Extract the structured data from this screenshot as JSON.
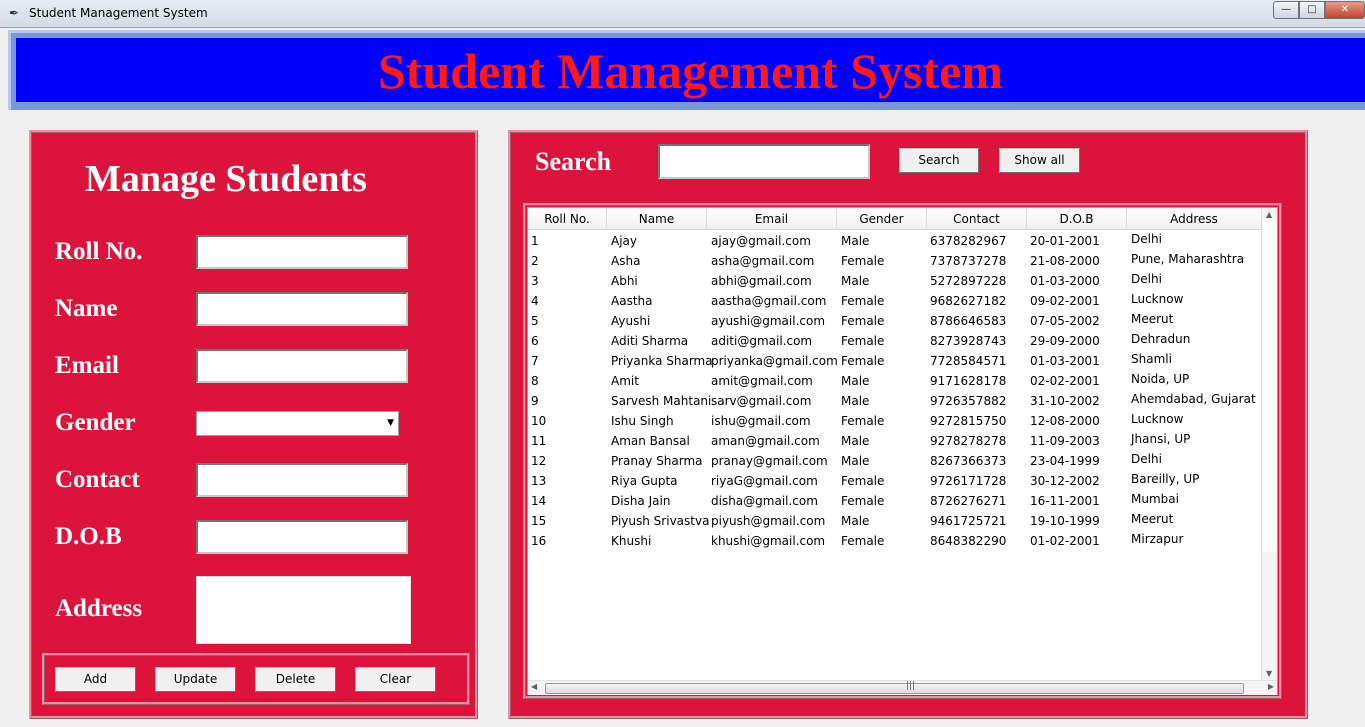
{
  "window": {
    "title": "Student Management System",
    "icon": "feather-icon"
  },
  "header": {
    "title": "Student Management System"
  },
  "colors": {
    "header_bg": "#0000ff",
    "header_text": "#ff1a1a",
    "panel_bg": "#dc143c",
    "panel_text": "#ffffff"
  },
  "manage": {
    "title": "Manage Students",
    "labels": {
      "roll": "Roll No.",
      "name": "Name",
      "email": "Email",
      "gender": "Gender",
      "contact": "Contact",
      "dob": "D.O.B",
      "address": "Address"
    },
    "values": {
      "roll": "",
      "name": "",
      "email": "",
      "gender": "",
      "contact": "",
      "dob": "",
      "address": ""
    },
    "buttons": {
      "add": "Add",
      "update": "Update",
      "delete": "Delete",
      "clear": "Clear"
    }
  },
  "search": {
    "label": "Search",
    "value": "",
    "search_button": "Search",
    "show_all_button": "Show all"
  },
  "table": {
    "columns": [
      "Roll No.",
      "Name",
      "Email",
      "Gender",
      "Contact",
      "D.O.B",
      "Address"
    ],
    "rows": [
      [
        "1",
        "Ajay",
        "ajay@gmail.com",
        "Male",
        "6378282967",
        "20-01-2001",
        "Delhi"
      ],
      [
        "2",
        "Asha",
        "asha@gmail.com",
        "Female",
        "7378737278",
        "21-08-2000",
        "Pune, Maharashtra"
      ],
      [
        "3",
        "Abhi",
        "abhi@gmail.com",
        "Male",
        "5272897228",
        "01-03-2000",
        "Delhi"
      ],
      [
        "4",
        "Aastha",
        "aastha@gmail.com",
        "Female",
        "9682627182",
        "09-02-2001",
        "Lucknow"
      ],
      [
        "5",
        "Ayushi",
        "ayushi@gmail.com",
        "Female",
        "8786646583",
        "07-05-2002",
        "Meerut"
      ],
      [
        "6",
        "Aditi Sharma",
        "aditi@gmail.com",
        "Female",
        "8273928743",
        "29-09-2000",
        "Dehradun"
      ],
      [
        "7",
        "Priyanka Sharma",
        "priyanka@gmail.com",
        "Female",
        "7728584571",
        "01-03-2001",
        "Shamli"
      ],
      [
        "8",
        "Amit",
        "amit@gmail.com",
        "Male",
        "9171628178",
        "02-02-2001",
        "Noida, UP"
      ],
      [
        "9",
        "Sarvesh Mahtani",
        "sarv@gmail.com",
        "Male",
        "9726357882",
        "31-10-2002",
        "Ahemdabad, Gujarat"
      ],
      [
        "10",
        "Ishu Singh",
        "ishu@gmail.com",
        "Female",
        "9272815750",
        "12-08-2000",
        "Lucknow"
      ],
      [
        "11",
        "Aman Bansal",
        "aman@gmail.com",
        "Male",
        "9278278278",
        "11-09-2003",
        "Jhansi, UP"
      ],
      [
        "12",
        "Pranay Sharma",
        "pranay@gmail.com",
        "Male",
        "8267366373",
        "23-04-1999",
        "Delhi"
      ],
      [
        "13",
        "Riya Gupta",
        "riyaG@gmail.com",
        "Female",
        "9726171728",
        "30-12-2002",
        "Bareilly, UP"
      ],
      [
        "14",
        "Disha Jain",
        "disha@gmail.com",
        "Female",
        "8726276271",
        "16-11-2001",
        "Mumbai"
      ],
      [
        "15",
        "Piyush Srivastva",
        "piyush@gmail.com",
        "Male",
        "9461725721",
        "19-10-1999",
        "Meerut"
      ],
      [
        "16",
        "Khushi",
        "khushi@gmail.com",
        "Female",
        "8648382290",
        "01-02-2001",
        "Mirzapur"
      ]
    ]
  }
}
